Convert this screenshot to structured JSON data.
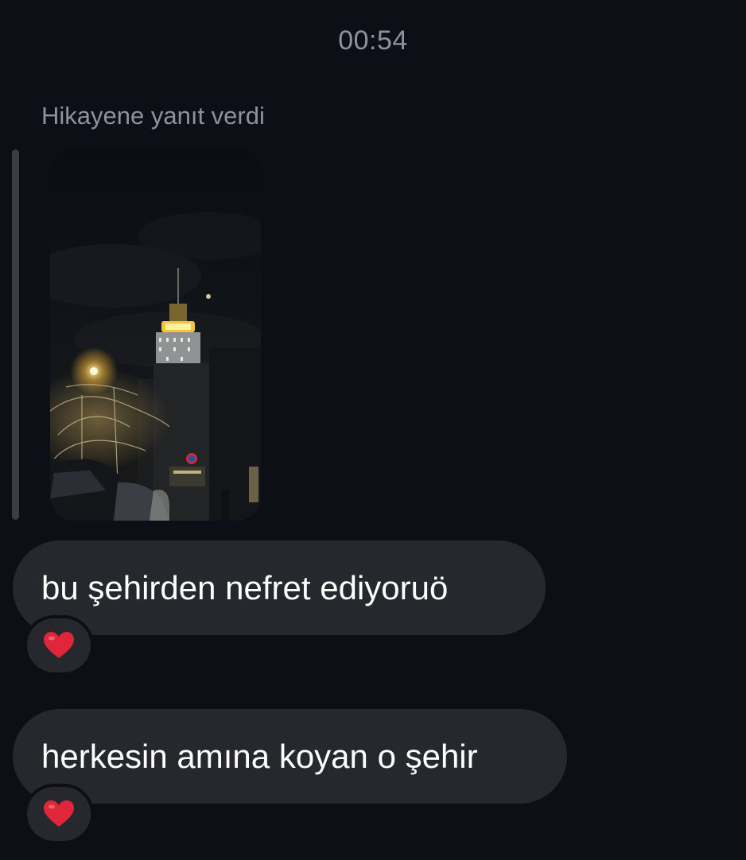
{
  "header": {
    "time": "00:54"
  },
  "reply": {
    "label": "Hikayene yanıt verdi"
  },
  "messages": [
    {
      "text": "bu şehirden nefret ediyoruö",
      "reaction": "heart-icon"
    },
    {
      "text": "herkesin amına koyan o şehir",
      "reaction": "heart-icon"
    }
  ],
  "colors": {
    "background": "#0c0f15",
    "bubble": "#26282d",
    "muted_text": "#8e929b",
    "reaction_heart": "#e0263a"
  }
}
